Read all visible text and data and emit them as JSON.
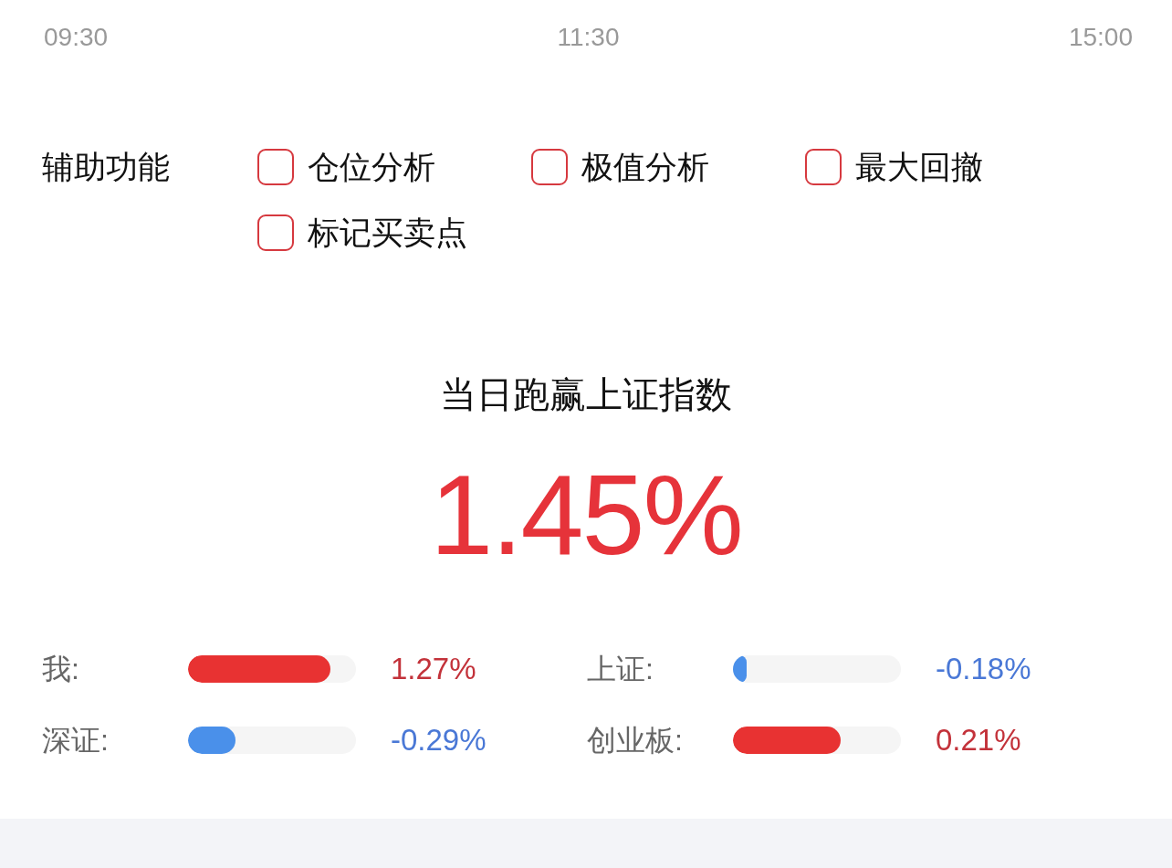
{
  "time_axis": {
    "labels": [
      "09:30",
      "11:30",
      "15:00"
    ]
  },
  "assist": {
    "label": "辅助功能",
    "options": [
      {
        "label": "仓位分析",
        "checked": false
      },
      {
        "label": "极值分析",
        "checked": false
      },
      {
        "label": "最大回撤",
        "checked": false
      },
      {
        "label": "标记买卖点",
        "checked": false
      }
    ]
  },
  "summary": {
    "title": "当日跑赢上证指数",
    "value": "1.45%",
    "kind": "up"
  },
  "comparisons": [
    {
      "label": "我:",
      "level": 0.85,
      "reading": "1.27%",
      "kind": "up"
    },
    {
      "label": "上证:",
      "level": 0.08,
      "reading": "-0.18%",
      "kind": "down"
    },
    {
      "label": "深证:",
      "level": 0.28,
      "reading": "-0.29%",
      "kind": "down"
    },
    {
      "label": "创业板:",
      "level": 0.64,
      "reading": "0.21%",
      "kind": "up"
    }
  ]
}
